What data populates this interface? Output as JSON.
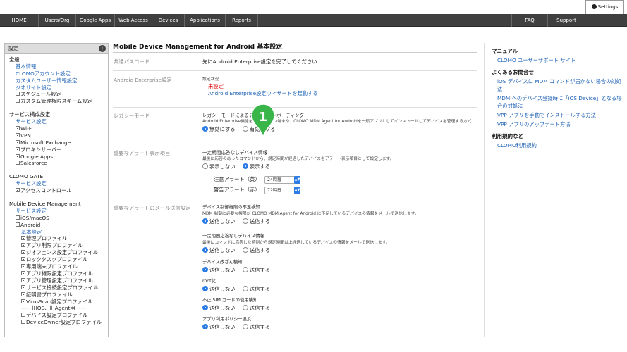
{
  "nav": {
    "items": [
      "HOME",
      "Users/Org",
      "Google Apps",
      "Web Access",
      "Devices",
      "Applications",
      "Reports",
      "FAQ",
      "Support"
    ],
    "settings": "Settings"
  },
  "sidebar": {
    "header": "設定",
    "collapse_icon": "‹",
    "sections": [
      {
        "title": "全般",
        "items": [
          "基本情報",
          "CLOMOアカウント設定",
          "カスタムユーザー情報設定",
          "ジオサイト設定",
          "スケジュール設定",
          "カスタム管理権限スキーム設定"
        ]
      },
      {
        "title": "サービス構成設定",
        "items": [
          "サービス設定",
          "Wi-Fi",
          "VPN",
          "Microsoft Exchange",
          "プロキシサーバー",
          "Google Apps",
          "Salesforce"
        ]
      },
      {
        "title": "CLOMO GATE",
        "items": [
          "サービス設定",
          "アクセスコントロール"
        ]
      },
      {
        "title": "Mobile Device Management",
        "items": [
          "サービス設定",
          "iOS/macOS",
          "Android",
          "基本設定",
          "管理プロファイル",
          "アプリ制限プロファイル",
          "ジオフェンス設定プロファイル",
          "ロックタスクプロファイル",
          "専用端末プロファイル",
          "アプリ権限設定プロファイル",
          "アプリ管理設定プロファイル",
          "サービス接続設定プロファイル",
          "証明書プロファイル",
          "VirusScan設定プロファイル",
          "----- 旧OS、旧Agent用 -----",
          "デバイス設定プロファイル",
          "DeviceOwner設定プロファイル"
        ]
      }
    ]
  },
  "main": {
    "title": "Mobile Device Management for Android 基本設定",
    "passcode": {
      "label": "共通パスコード",
      "value": "先にAndroid Enterprise設定を完了してください"
    },
    "ae": {
      "label": "Android Enterprise設定",
      "status_label": "設定状況",
      "status": "未設定",
      "wizard_link": "Android Enterprise設定ウィザードを起動する"
    },
    "legacy": {
      "label": "レガシーモード",
      "heading": "レガシーモードによるデバイスオンボーディング",
      "desc": "Android Enterprise機能を利用できない端末や、CLOMO MDM Agent for Androidを一般アプリとしてインストールしてデバイスを管理する方式",
      "opt_off": "無効にする",
      "opt_on": "有効にする"
    },
    "alert": {
      "label": "重要なアラート表示項目",
      "heading": "一定期間応答なしデバイス情報",
      "desc": "最後に応答のあったコマンドから、規定時間が経過したデバイスをアラート表示項目として設定します。",
      "opt_hide": "表示しない",
      "opt_show": "表示する",
      "yellow_label": "注意アラート（黄）",
      "yellow_value": "24時間",
      "red_label": "警告アラート（赤）",
      "red_value": "72時間"
    },
    "mail": {
      "label": "重要なアラートのメール送信設定",
      "items": [
        {
          "heading": "デバイス制御権限の不足検知",
          "desc": "MDM 制御に必要な権限が CLOMO MDM Agent for Android に不足しているデバイスの情報をメールで送信します。",
          "opt_no": "送信しない",
          "opt_yes": "送信する"
        },
        {
          "heading": "一定期間応答なしデバイス情報",
          "desc": "最後にコマンドに応答した時刻から規定時間以上経過しているデバイスの情報をメールで送信します。",
          "opt_no": "送信しない",
          "opt_yes": "送信する"
        },
        {
          "heading": "デバイス改ざん検知",
          "desc": "",
          "opt_no": "送信しない",
          "opt_yes": "送信する"
        },
        {
          "heading": "root化",
          "desc": "",
          "opt_no": "送信しない",
          "opt_yes": "送信する"
        },
        {
          "heading": "不正 SIM カードの使用検知",
          "desc": "",
          "opt_no": "送信しない",
          "opt_yes": "送信する"
        },
        {
          "heading": "アプリ利用ポリシー違反",
          "desc": "",
          "opt_no": "送信しない",
          "opt_yes": "送信する"
        }
      ]
    },
    "badge": "1"
  },
  "right": {
    "manual_title": "マニュアル",
    "manual_links": [
      "CLOMO ユーザーサポート サイト"
    ],
    "faq_title": "よくあるお問合せ",
    "faq_links": [
      "iOS デバイスに MDM コマンドが届かない場合の対処法",
      "MDM へのデバイス登録時に「iOS Device」となる場合の対処法",
      "VPP アプリを手動でインストールする方法",
      "VPP アプリのアップデート方法"
    ],
    "terms_title": "利用規約など",
    "terms_links": [
      "CLOMO利用規約"
    ]
  },
  "colors": {
    "nav_bg": "#3f3f3f",
    "link": "#1a5fb4",
    "radio_on": "#2a7be4",
    "badge": "#3ab54a",
    "alert_red": "#dd0000"
  }
}
